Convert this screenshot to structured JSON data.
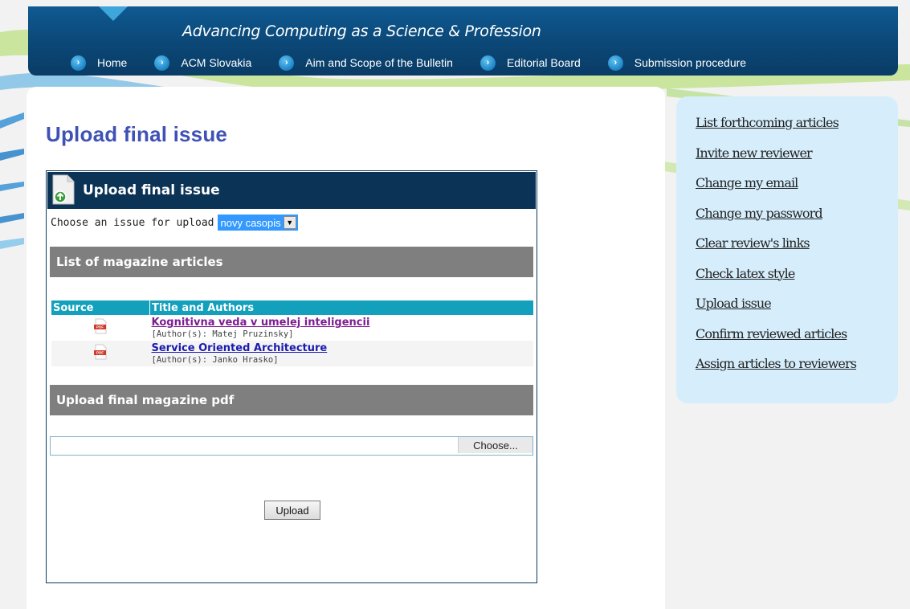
{
  "header": {
    "tagline": "Advancing Computing as a Science & Profession",
    "nav": [
      {
        "label": "Home"
      },
      {
        "label": "ACM Slovakia"
      },
      {
        "label": "Aim and Scope of the Bulletin"
      },
      {
        "label": "Editorial Board"
      },
      {
        "label": "Submission procedure"
      }
    ]
  },
  "main": {
    "page_title": "Upload final issue",
    "box_title": "Upload final issue",
    "choose_label": "Choose an issue for upload",
    "issue_select": {
      "selected": "novy casopis"
    },
    "articles_heading": "List of magazine articles",
    "table": {
      "columns": [
        "Source",
        "Title and Authors"
      ],
      "rows": [
        {
          "icon": "pdf-icon",
          "icon_text": "PDF",
          "title": "Kognitivna veda v umelej inteligencii",
          "authors": "[Author(s): Matej Pruzinsky]"
        },
        {
          "icon": "pdf-icon",
          "icon_text": "PDF",
          "title": "Service Oriented Architecture",
          "authors": "[Author(s): Janko Hrasko]"
        }
      ]
    },
    "upload_heading": "Upload final magazine pdf",
    "file_input": {
      "button_label": "Choose..."
    },
    "upload_button": "Upload"
  },
  "sidebar": {
    "links": [
      {
        "label": "List forthcoming articles"
      },
      {
        "label": "Invite new reviewer"
      },
      {
        "label": "Change my email"
      },
      {
        "label": "Change my password"
      },
      {
        "label": "Clear review's links"
      },
      {
        "label": "Check latex style"
      },
      {
        "label": "Upload issue"
      },
      {
        "label": "Confirm reviewed articles"
      },
      {
        "label": "Assign articles to reviewers"
      }
    ]
  },
  "colors": {
    "header_blue": "#0b4776",
    "title_blue": "#3f51b5",
    "table_header": "#13a0bd",
    "section_gray": "#7f7f7f",
    "sidebar_bg": "#d6eefc"
  }
}
